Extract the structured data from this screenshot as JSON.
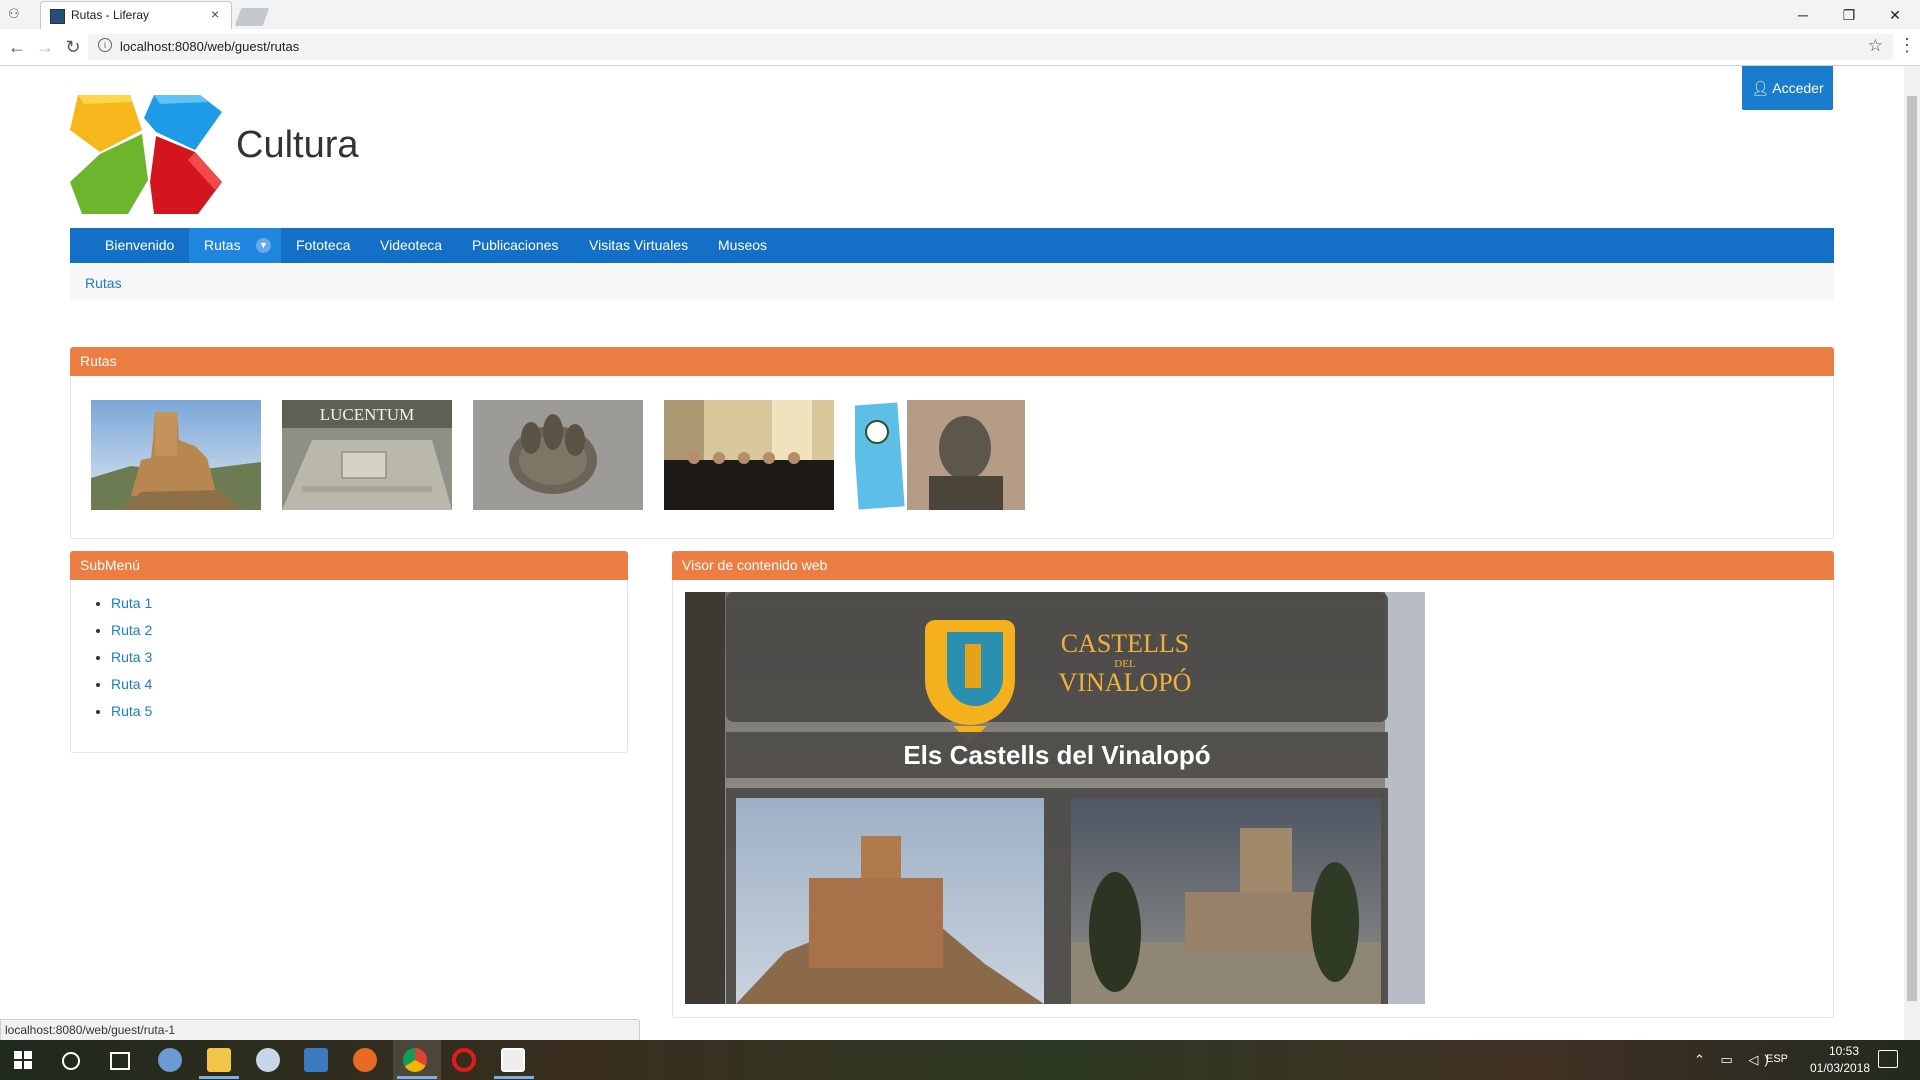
{
  "browser": {
    "tab_title": "Rutas - Liferay",
    "tab_close": "×",
    "url": "localhost:8080/web/guest/rutas",
    "status_url": "localhost:8080/web/guest/ruta-1",
    "window_controls": {
      "minimize": "─",
      "maximize": "❐",
      "close": "✕"
    }
  },
  "page": {
    "sign_in_label": "Acceder",
    "site_title": "Cultura",
    "nav": {
      "items": [
        "Bienvenido",
        "Rutas",
        "Fototeca",
        "Videoteca",
        "Publicaciones",
        "Visitas Virtuales",
        "Museos"
      ],
      "active": "Rutas"
    },
    "breadcrumb": "Rutas",
    "rutas_portlet": {
      "title": "Rutas",
      "thumbnails": [
        {
          "icon": "castle-photo"
        },
        {
          "icon": "lucentum-ruins-photo",
          "caption": "LUCENTUM"
        },
        {
          "icon": "dinosaur-footprint-photo"
        },
        {
          "icon": "choir-photo"
        },
        {
          "icon": "ruta-benlliure-photo"
        }
      ]
    },
    "submenu": {
      "title": "SubMenú",
      "items": [
        "Ruta 1",
        "Ruta 2",
        "Ruta 3",
        "Ruta 4",
        "Ruta 5"
      ]
    },
    "visor": {
      "title": "Visor de contenido web",
      "brand_line1": "CASTELLS",
      "brand_line2": "DEL",
      "brand_line3": "VINALOPÓ",
      "heading": "Els Castells del Vinalopó"
    }
  },
  "taskbar": {
    "lang": "ESP",
    "time": "10:53",
    "date": "01/03/2018"
  },
  "colors": {
    "nav_blue": "#1470c7",
    "portlet_orange": "#ec7d43",
    "link_blue": "#1a7ccc"
  }
}
